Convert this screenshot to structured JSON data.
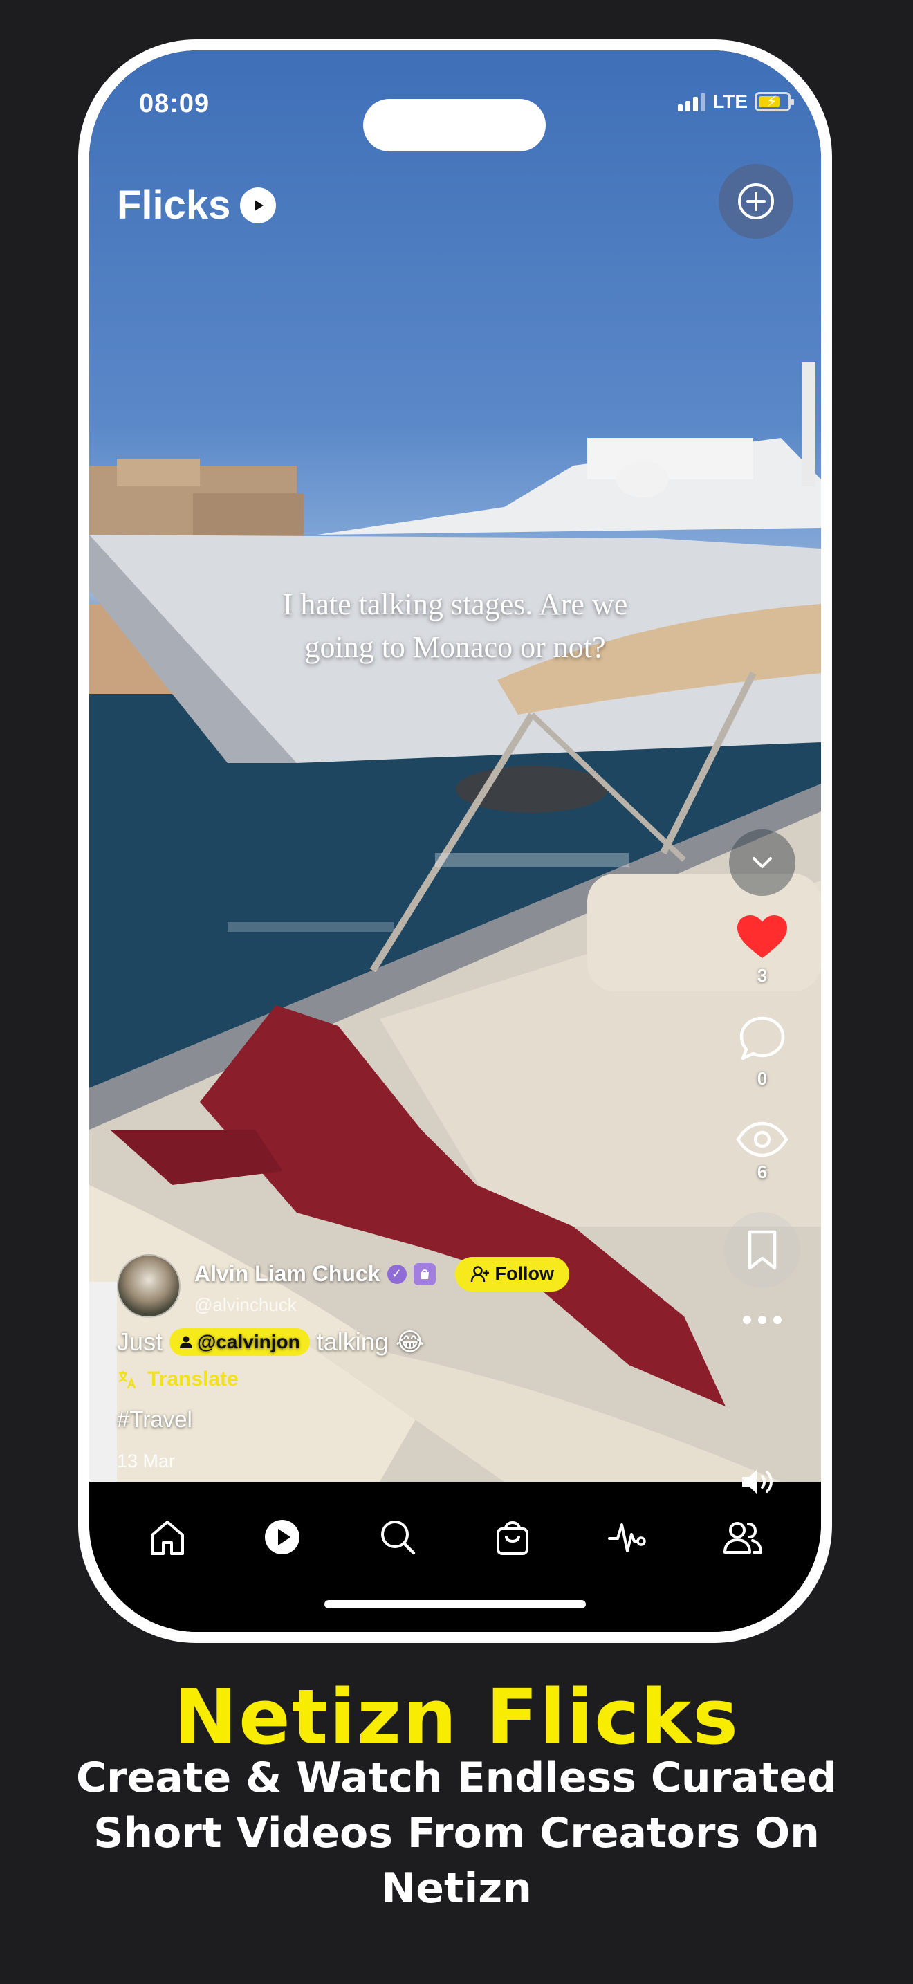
{
  "status_bar": {
    "time": "08:09",
    "network": "LTE"
  },
  "header": {
    "title": "Flicks"
  },
  "video": {
    "caption_line1": "I hate talking stages. Are we",
    "caption_line2": "going to Monaco or not?"
  },
  "actions": {
    "likes": "3",
    "comments": "0",
    "views": "6",
    "like_color": "#ff2d2d"
  },
  "creator": {
    "name": "Alvin Liam Chuck",
    "handle": "@alvinchuck",
    "follow_label": "Follow",
    "post_prefix": "Just",
    "mention": "@calvinjon",
    "post_suffix": "talking 😂",
    "translate_label": "Translate",
    "hashtag": "#Travel",
    "date": "13 Mar"
  },
  "nav": {
    "items": [
      "home",
      "flicks",
      "search",
      "shop",
      "activity",
      "people"
    ]
  },
  "promo": {
    "title": "Netizn Flicks",
    "subtitle_line1": "Create & Watch Endless Curated",
    "subtitle_line2": "Short Videos From Creators On",
    "subtitle_line3": "Netizn"
  },
  "colors": {
    "accent_yellow": "#f7ea1c",
    "background": "#1d1d1f",
    "badge_purple": "#8f6bd6"
  }
}
